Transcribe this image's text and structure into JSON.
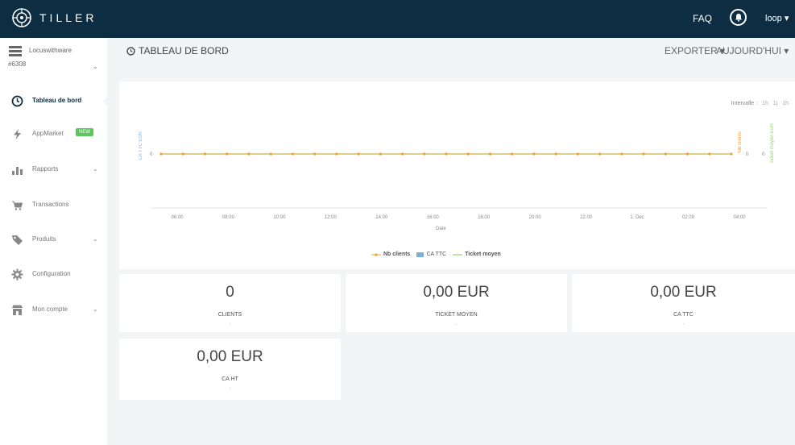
{
  "header": {
    "brand": "TILLER",
    "faq": "FAQ",
    "user": "loop ▾"
  },
  "sidebar": {
    "store_name": "Locuswithware",
    "store_code": "#6308",
    "items": [
      {
        "label": "Tableau de bord",
        "icon": "clock-icon",
        "active": true
      },
      {
        "label": "AppMarket",
        "icon": "bolt-icon",
        "badge": "NEW"
      },
      {
        "label": "Rapports",
        "icon": "bar-chart-icon",
        "has_chevron": true
      },
      {
        "label": "Transactions",
        "icon": "cart-icon"
      },
      {
        "label": "Produits",
        "icon": "tag-icon",
        "has_chevron": true
      },
      {
        "label": "Configuration",
        "icon": "gear-icon"
      },
      {
        "label": "Mon compte",
        "icon": "store-icon",
        "has_chevron": true
      }
    ]
  },
  "page": {
    "title": "TABLEAU DE BORD",
    "export": "EXPORTER ▾",
    "period": "AUJOURD'HUI ▾"
  },
  "chart_data": {
    "type": "line",
    "interval_label": "Intervalle :",
    "interval_options": [
      "1h",
      "1j",
      "1h"
    ],
    "ylabel_left": "CA TTC EUR",
    "ylabel_right_1": "Nb clients",
    "ylabel_right_2": "Ticket moyen EUR",
    "xlabel": "Date",
    "x": [
      "06:00",
      "08:00",
      "10:00",
      "12:00",
      "14:00",
      "16:00",
      "18:00",
      "20:00",
      "22:00",
      "1. Dec",
      "02:00",
      "04:00"
    ],
    "series": [
      {
        "name": "Nb clients",
        "color": "#f0a030",
        "values": [
          0,
          0,
          0,
          0,
          0,
          0,
          0,
          0,
          0,
          0,
          0,
          0
        ]
      },
      {
        "name": "CA TTC",
        "color": "#7ab0e0",
        "values": [
          0,
          0,
          0,
          0,
          0,
          0,
          0,
          0,
          0,
          0,
          0,
          0
        ]
      },
      {
        "name": "Ticket moyen",
        "color": "#8fd16a",
        "values": [
          0,
          0,
          0,
          0,
          0,
          0,
          0,
          0,
          0,
          0,
          0,
          0
        ]
      }
    ],
    "left_tick": "0",
    "right_tick_1": "0",
    "right_tick_2": "0"
  },
  "kpis": [
    {
      "value": "0",
      "label": "CLIENTS",
      "sub": "-"
    },
    {
      "value": "0,00 EUR",
      "label": "TICKET MOYEN",
      "sub": "-"
    },
    {
      "value": "0,00 EUR",
      "label": "CA TTC",
      "sub": "-"
    },
    {
      "value": "0,00 EUR",
      "label": "CA HT",
      "sub": "-"
    }
  ]
}
